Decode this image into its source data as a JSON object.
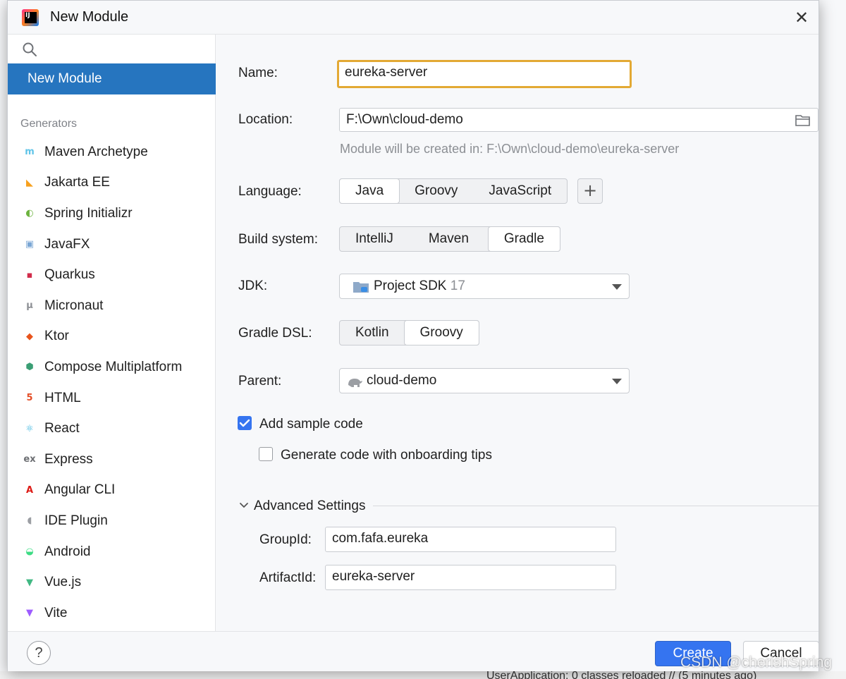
{
  "window": {
    "title": "New Module",
    "close_glyph": "✕"
  },
  "sidebar": {
    "search_placeholder": "",
    "selected": "New Module",
    "section_label": "Generators",
    "items": [
      {
        "label": "Maven Archetype",
        "icon": "maven-icon",
        "glyph": "m",
        "color": "#5fc4e8"
      },
      {
        "label": "Jakarta EE",
        "icon": "jakarta-icon",
        "glyph": "◣",
        "color": "#f7a01d"
      },
      {
        "label": "Spring Initializr",
        "icon": "spring-icon",
        "glyph": "◐",
        "color": "#6db33f"
      },
      {
        "label": "JavaFX",
        "icon": "javafx-icon",
        "glyph": "▣",
        "color": "#7aa6d4"
      },
      {
        "label": "Quarkus",
        "icon": "quarkus-icon",
        "glyph": "▪",
        "color": "#d12c4a"
      },
      {
        "label": "Micronaut",
        "icon": "micronaut-icon",
        "glyph": "μ",
        "color": "#8c8f94"
      },
      {
        "label": "Ktor",
        "icon": "ktor-icon",
        "glyph": "◆",
        "color": "#e8541c"
      },
      {
        "label": "Compose Multiplatform",
        "icon": "compose-icon",
        "glyph": "⬢",
        "color": "#3a9e74"
      },
      {
        "label": "HTML",
        "icon": "html-icon",
        "glyph": "5",
        "color": "#e44d26"
      },
      {
        "label": "React",
        "icon": "react-icon",
        "glyph": "⚛",
        "color": "#3ab6e0"
      },
      {
        "label": "Express",
        "icon": "express-icon",
        "glyph": "ex",
        "color": "#6d6f73"
      },
      {
        "label": "Angular CLI",
        "icon": "angular-icon",
        "glyph": "A",
        "color": "#dd1b16"
      },
      {
        "label": "IDE Plugin",
        "icon": "plugin-icon",
        "glyph": "◖",
        "color": "#9b9ea3"
      },
      {
        "label": "Android",
        "icon": "android-icon",
        "glyph": "◒",
        "color": "#3ddc84"
      },
      {
        "label": "Vue.js",
        "icon": "vue-icon",
        "glyph": "▼",
        "color": "#41b883"
      },
      {
        "label": "Vite",
        "icon": "vite-icon",
        "glyph": "▼",
        "color": "#9d5cff"
      }
    ]
  },
  "form": {
    "name_label": "Name:",
    "name_value": "eureka-server",
    "location_label": "Location:",
    "location_value": "F:\\Own\\cloud-demo",
    "location_hint": "Module will be created in: F:\\Own\\cloud-demo\\eureka-server",
    "language_label": "Language:",
    "languages": [
      "Java",
      "Groovy",
      "JavaScript"
    ],
    "language_selected": "Java",
    "add_language_glyph": "+",
    "build_label": "Build system:",
    "build_systems": [
      "IntelliJ",
      "Maven",
      "Gradle"
    ],
    "build_selected": "Gradle",
    "jdk_label": "JDK:",
    "jdk_value": "Project SDK",
    "jdk_version": "17",
    "dsl_label": "Gradle DSL:",
    "dsls": [
      "Kotlin",
      "Groovy"
    ],
    "dsl_selected": "Groovy",
    "parent_label": "Parent:",
    "parent_value": "cloud-demo",
    "sample_code_label": "Add sample code",
    "sample_code_checked": true,
    "onboarding_label": "Generate code with onboarding tips",
    "onboarding_checked": false,
    "advanced_label": "Advanced Settings",
    "groupid_label": "GroupId:",
    "groupid_value": "com.fafa.eureka",
    "artifactid_label": "ArtifactId:",
    "artifactid_value": "eureka-server"
  },
  "footer": {
    "help_glyph": "?",
    "create_label": "Create",
    "cancel_label": "Cancel"
  },
  "background": {
    "status_text": "UserApplication: 0 classes reloaded // (5 minutes ago)",
    "watermark": "CSDN @cherishSpring"
  },
  "colors": {
    "accent": "#3574f0",
    "sidebar_selected": "#2675bf",
    "focus_border": "#e3a934"
  }
}
